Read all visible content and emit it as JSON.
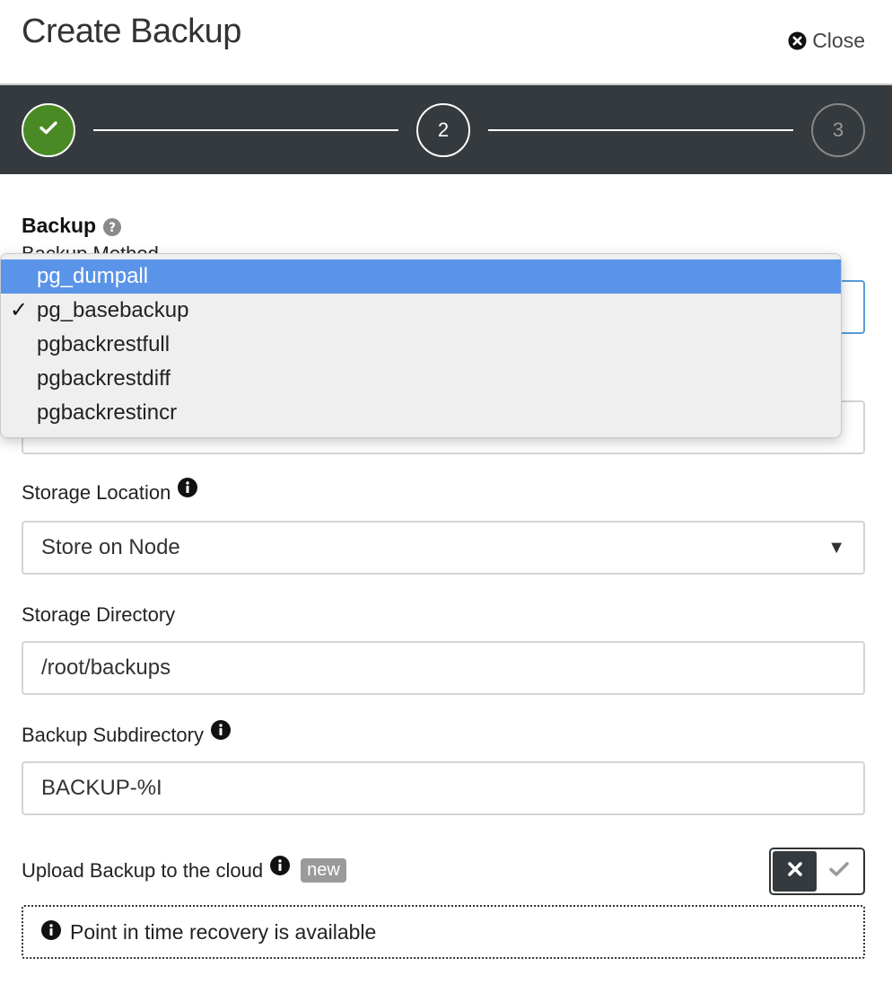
{
  "dialog": {
    "title": "Create Backup",
    "close_label": "Close"
  },
  "stepper": {
    "steps": [
      {
        "label": "",
        "state": "complete"
      },
      {
        "label": "2",
        "state": "current"
      },
      {
        "label": "3",
        "state": "upcoming"
      }
    ]
  },
  "section": {
    "title": "Backup",
    "method_label": "Backup Method"
  },
  "backup_method": {
    "selected": "pg_basebackup",
    "options": [
      {
        "label": "pg_dumpall",
        "highlighted": true,
        "checked": false
      },
      {
        "label": "pg_basebackup",
        "highlighted": false,
        "checked": true
      },
      {
        "label": "pgbackrestfull",
        "highlighted": false,
        "checked": false
      },
      {
        "label": "pgbackrestdiff",
        "highlighted": false,
        "checked": false
      },
      {
        "label": "pgbackrestincr",
        "highlighted": false,
        "checked": false
      }
    ]
  },
  "storage_location": {
    "label": "Storage Location",
    "value": "Store on Node"
  },
  "storage_directory": {
    "label": "Storage Directory",
    "value": "/root/backups"
  },
  "backup_subdirectory": {
    "label": "Backup Subdirectory",
    "value": "BACKUP-%I"
  },
  "cloud_upload": {
    "label": "Upload Backup to the cloud",
    "badge": "new",
    "enabled": false
  },
  "notice": {
    "text": "Point in time recovery is available"
  },
  "colors": {
    "stepper_bg": "#343a3e",
    "step_complete": "#4a8a24",
    "highlight": "#5a94e8",
    "focus_border": "#5b9ad9"
  },
  "icons": {
    "close": "close-circle-icon",
    "step_complete": "check-icon",
    "help": "question-circle-icon",
    "info": "info-circle-icon",
    "toggle_off": "x-icon",
    "toggle_on": "checkmark-icon",
    "select_caret": "caret-down-icon"
  }
}
